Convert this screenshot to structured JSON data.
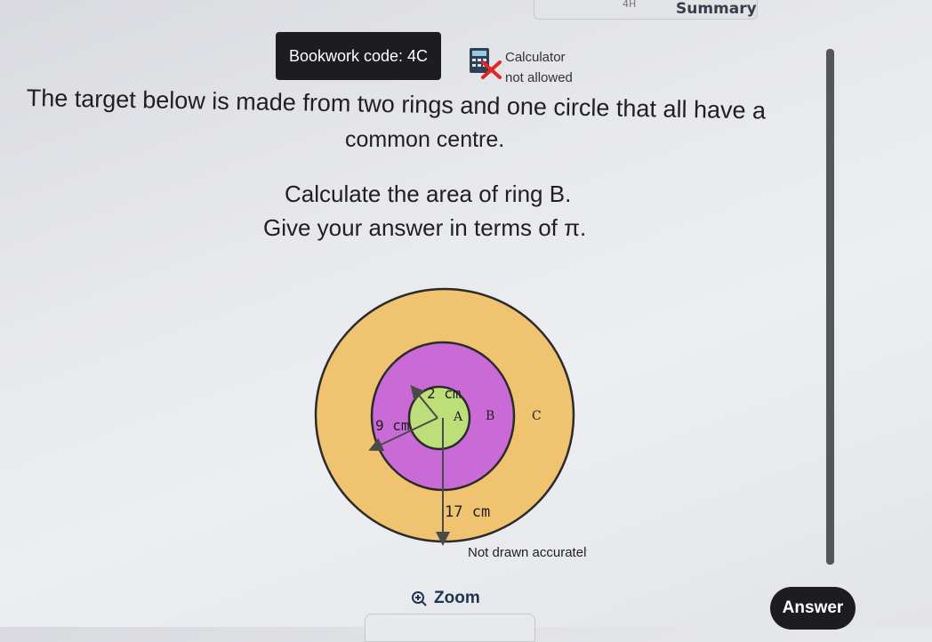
{
  "header": {
    "summary_label": "Summary",
    "top_mark": "4H"
  },
  "bookwork": {
    "label": "Bookwork code: 4C"
  },
  "calculator": {
    "label": "Calculator",
    "status": "not allowed",
    "icon": "calculator-not-allowed-icon"
  },
  "question": {
    "line1": "The target below is made from two rings and one circle that all have a",
    "line2": "common centre.",
    "instruction1": "Calculate the area of ring B.",
    "instruction2": "Give your answer in terms of π."
  },
  "diagram": {
    "radius_a_label": "2 cm",
    "radius_b_label": "9 cm",
    "radius_c_label": "17 cm",
    "label_a": "A",
    "label_b": "B",
    "label_c": "C",
    "note": "Not drawn accurately",
    "colors": {
      "outer": "#efc36f",
      "middle": "#c96ad7",
      "inner": "#bcdf79",
      "stroke": "#2b2b2b"
    }
  },
  "actions": {
    "zoom_label": "Zoom",
    "answer_label": "Answer"
  }
}
